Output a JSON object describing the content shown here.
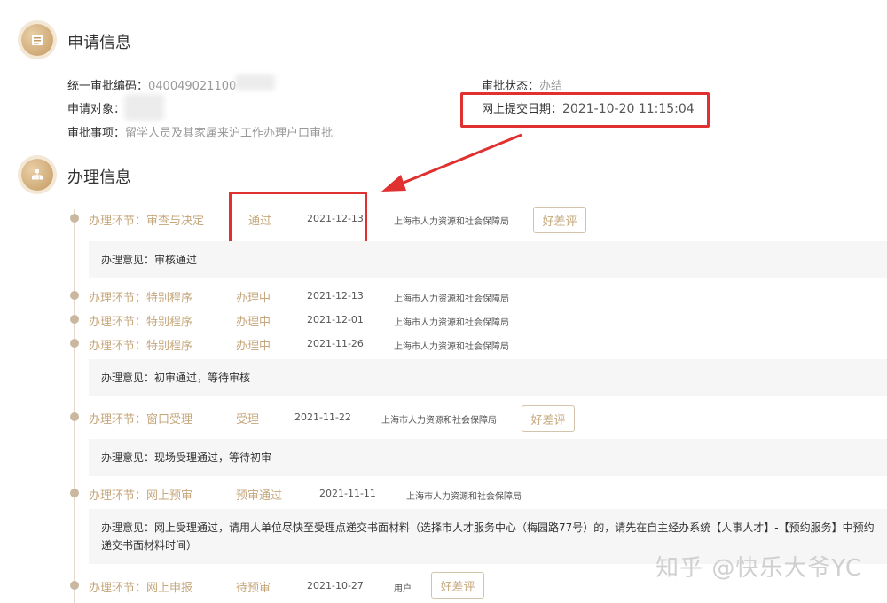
{
  "application": {
    "title": "申请信息",
    "fields": {
      "code_label": "统一审批编码：",
      "code_value": "040049021100",
      "applicant_label": "申请对象：",
      "item_label": "审批事项：",
      "item_value": "留学人员及其家属来沪工作办理户口审批",
      "status_label": "审批状态：",
      "status_value": "办结",
      "submit_label": "网上提交日期：",
      "submit_value": "2021-10-20 11:15:04"
    }
  },
  "process": {
    "title": "办理信息",
    "steps": [
      {
        "node": "办理环节：审查与决定",
        "state": "通过",
        "date": "2021-12-13",
        "dept": "上海市人力资源和社会保障局",
        "rate": "好差评"
      },
      {
        "node": "办理环节：特别程序",
        "state": "办理中",
        "date": "2021-12-13",
        "dept": "上海市人力资源和社会保障局"
      },
      {
        "node": "办理环节：特别程序",
        "state": "办理中",
        "date": "2021-12-01",
        "dept": "上海市人力资源和社会保障局"
      },
      {
        "node": "办理环节：特别程序",
        "state": "办理中",
        "date": "2021-11-26",
        "dept": "上海市人力资源和社会保障局"
      },
      {
        "node": "办理环节：窗口受理",
        "state": "受理",
        "date": "2021-11-22",
        "dept": "上海市人力资源和社会保障局",
        "rate": "好差评"
      },
      {
        "node": "办理环节：网上预审",
        "state": "预审通过",
        "date": "2021-11-11",
        "dept": "上海市人力资源和社会保障局"
      },
      {
        "node": "办理环节：网上申报",
        "state": "待预审",
        "date": "2021-10-27",
        "dept": "用户",
        "rate": "好差评"
      }
    ],
    "opinions": [
      "办理意见：审核通过",
      "办理意见：初审通过，等待审核",
      "办理意见：现场受理通过，等待初审",
      "办理意见：网上受理通过，请用人单位尽快至受理点递交书面材料（选择市人才服务中心（梅园路77号）的，请先在自主经办系统【人事人才】-【预约服务】中预约递交书面材料时间）"
    ]
  },
  "watermark": "知乎 @快乐大爷YC",
  "colors": {
    "accent_gold": "#c6a77c",
    "annotation_red": "#e03030"
  }
}
